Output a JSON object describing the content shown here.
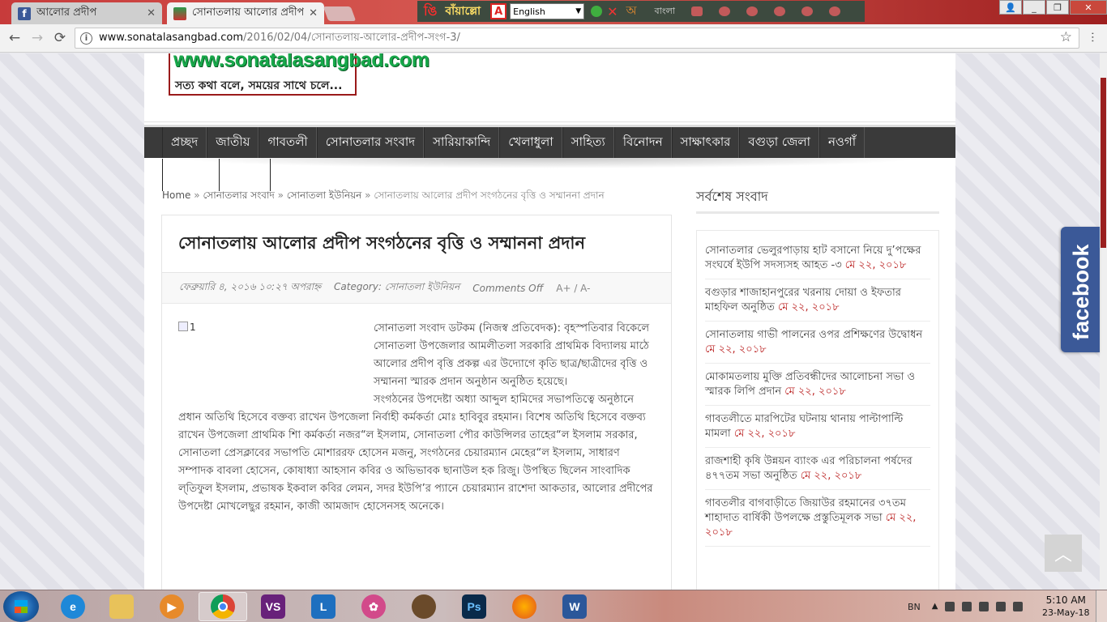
{
  "browser": {
    "tabs": [
      {
        "title": "আলোর প্রদীপ",
        "active": false
      },
      {
        "title": "সোনাতলায় আলোর প্রদীপ স",
        "active": true
      }
    ],
    "url_host": "www.sonatalasangbad.com",
    "url_path": "/2016/02/04/সোনাতলায়-আলোর-প্রদীপ-সংগ-3/"
  },
  "avro": {
    "logo": "ঙি",
    "mode": "বাঁয়াল্লো",
    "language_select": "English",
    "bangla_label": "বাংলা",
    "a_label": "অ"
  },
  "site": {
    "logo_text": "www.sonatalasangbad.com",
    "tagline": "সত্য কথা বলে, সময়ের সাথে চলে..."
  },
  "nav": [
    "প্রচ্ছদ",
    "জাতীয়",
    "গাবতলী",
    "সোনাতলার সংবাদ",
    "সারিয়াকান্দি",
    "খেলাধুলা",
    "সাহিত্য",
    "বিনোদন",
    "সাক্ষাৎকার",
    "বগুড়া জেলা",
    "নওগাঁ"
  ],
  "breadcrumb": {
    "home": "Home",
    "sep": "»",
    "cat": "সোনাতলার সংবাদ",
    "subcat": "সোনাতলা ইউনিয়ন",
    "current": "সোনাতলায় আলোর প্রদীপ সংগঠনের বৃত্তি ও সম্মাননা প্রদান"
  },
  "article": {
    "title": "সোনাতলায় আলোর প্রদীপ সংগঠনের বৃত্তি ও সম্মাননা প্রদান",
    "date": "ফেব্রুয়ারি ৪, ২০১৬ ১০:২৭ অপরাহ্ন",
    "category": "Category: সোনাতলা ইউনিয়ন",
    "comments": "Comments Off",
    "font_size": "A+ / A-",
    "image_alt": "1",
    "para1": "সোনাতলা সংবাদ ডটকম (নিজস্ব প্রতিবেদক): বৃহস্পতিবার বিকেলে সোনাতলা উপজেলার আমলীতলা সরকারি প্রাথমিক বিদ্যালয় মাঠে আলোর প্রদীপ বৃত্তি প্রকল্প এর উদ্যোগে কৃতি ছাত্র/ছাত্রীদের বৃত্তি ও সম্মাননা স্মারক প্রদান অনুষ্ঠান অনুষ্ঠিত হয়েছে।",
    "para2": "সংগঠনের উপদেষ্টা অধ্যা আব্দুল হামিদের সভাপতিত্বে অনুষ্ঠানে প্রধান অতিথি হিসেবে বক্তব্য রাখেন উপজেলা নির্বাহী কর্মকর্তা মোঃ হাবিবুর রহমান। বিশেষ অতিথি হিসেবে বক্তব্য রাখেন উপজেলা প্রাথমিক শিা কর্মকর্তা নজর“ল ইসলাম, সোনাতলা পৌর কাউন্সিলর তাহের“ল ইসলাম সরকার, সোনাতলা প্রেসক্লাবের সভাপতি মোশাররফ হোসেন মজনু, সংগঠনের চেয়ারম্যান মেহের“ল ইসলাম, সাধারণ সম্পাদক বাবলা হোসেন, কোষাধ্যা আহসান কবির ও অভিভাবক ছানাউল হক রিজু। উপস্থিত ছিলেন সাংবাদিক ল্‌তিফুল ইসলাম, প্রভাষক ইকবাল কবির লেমন, সদর ইউপি’র প্যানে চেয়ারম্যান রাশেদা আকতার, আলোর প্রদীপের উপদেষ্টা মোখলেছুর রহমান, কাজী আমজাদ হোসেনসহ অনেকে।"
  },
  "sidebar": {
    "title": "সর্বশেষ সংবাদ",
    "items": [
      {
        "text": "সোনাতলার ভেলুরপাড়ায় হাট বসানো নিয়ে দু’পক্ষের সংঘর্ষে ইউপি সদস্যসহ আহত -৩",
        "date": "মে ২২, ২০১৮"
      },
      {
        "text": "বগুড়ার শাজাহানপুরের খরনায় দোয়া ও ইফতার মাহফিল অনুষ্ঠিত",
        "date": "মে ২২, ২০১৮"
      },
      {
        "text": "সোনাতলায় গাভী পালনের ওপর প্রশিক্ষণের উদ্বোধন",
        "date": "মে ২২, ২০১৮"
      },
      {
        "text": "মোকামতলায় মুক্তি প্রতিবন্ধীদের আলোচনা সভা ও স্মারক লিপি প্রদান",
        "date": "মে ২২, ২০১৮"
      },
      {
        "text": "গাবতলীতে মারপিটের ঘটনায় থানায় পাল্টাপাল্টি মামলা",
        "date": "মে ২২, ২০১৮"
      },
      {
        "text": "রাজশাহী কৃষি উন্নয়ন ব্যাংক এর পরিচালনা পর্ষদের ৪৭৭তম সভা অনুষ্ঠিত",
        "date": "মে ২২, ২০১৮"
      },
      {
        "text": "গাবতলীর বাগবাড়ীতে জিয়াউর রহমানের ৩৭তম শাহাদাত বার্ষিকী উপলক্ষে প্রস্তুতিমূলক সভা",
        "date": "মে ২২, ২০১৮"
      }
    ]
  },
  "facebook_label": "facebook",
  "taskbar": {
    "lang": "BN",
    "time": "5:10 AM",
    "date": "23-May-18"
  }
}
